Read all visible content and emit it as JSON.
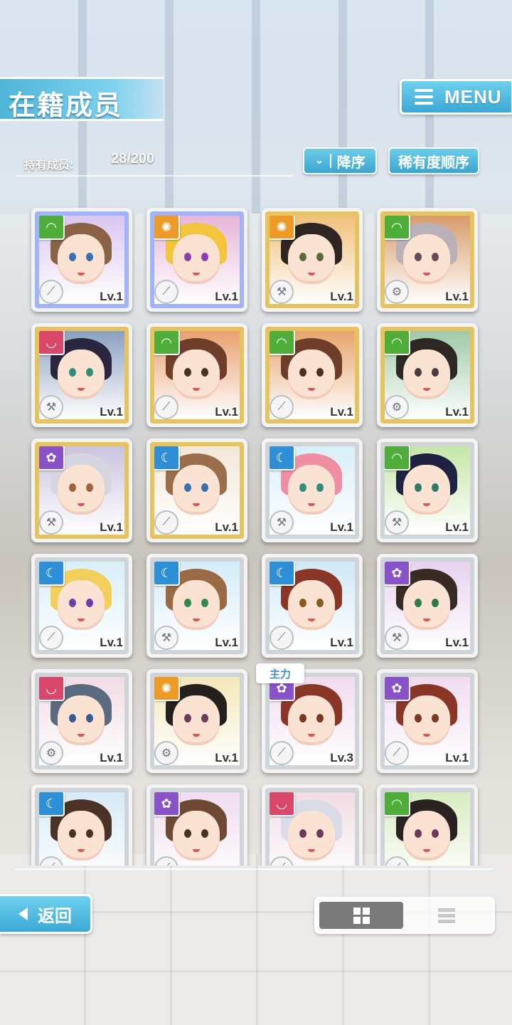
{
  "header": {
    "title": "在籍成员",
    "menu_label": "MENU",
    "member_label": "持有成员:",
    "member_count": "28/200",
    "sort_order_label": "降序",
    "sort_order_icon": "double-chevron-down-icon",
    "sort_key_label": "稀有度顺序"
  },
  "leader_tag": "主力",
  "cards": [
    {
      "level": "Lv.1",
      "attr": "green",
      "type": "sword",
      "frame": "rainbow",
      "hair": "#8a6246",
      "eyes": "#3a6fb0",
      "bg": "#d9c7ef"
    },
    {
      "level": "Lv.1",
      "attr": "orange",
      "type": "sword",
      "frame": "rainbow",
      "hair": "#f3c53a",
      "eyes": "#8b3fa8",
      "bg": "#e7b5d8"
    },
    {
      "level": "Lv.1",
      "attr": "orange",
      "type": "wrench",
      "frame": "gold",
      "hair": "#2e2523",
      "eyes": "#5a6a3a",
      "bg": "#f0c07a"
    },
    {
      "level": "Lv.1",
      "attr": "green",
      "type": "gear",
      "frame": "gold",
      "hair": "#b9b0b8",
      "eyes": "#6b4a5a",
      "bg": "#d79b6a"
    },
    {
      "level": "Lv.1",
      "attr": "pink",
      "type": "wrench",
      "frame": "gold",
      "hair": "#2a2640",
      "eyes": "#2f8f7a",
      "bg": "#8aa0c0"
    },
    {
      "level": "Lv.1",
      "attr": "green",
      "type": "sword",
      "frame": "gold",
      "hair": "#6e3e2a",
      "eyes": "#4a3020",
      "bg": "#e9a070"
    },
    {
      "level": "Lv.1",
      "attr": "green",
      "type": "sword",
      "frame": "gold",
      "hair": "#6e3e2a",
      "eyes": "#4a3020",
      "bg": "#e7a46c"
    },
    {
      "level": "Lv.1",
      "attr": "green",
      "type": "gear",
      "frame": "gold",
      "hair": "#2e2824",
      "eyes": "#4a3a40",
      "bg": "#9fc9a8"
    },
    {
      "level": "Lv.1",
      "attr": "purple",
      "type": "wrench",
      "frame": "gold",
      "hair": "#d6d6e2",
      "eyes": "#a0623a",
      "bg": "#c9c3e0"
    },
    {
      "level": "Lv.1",
      "attr": "blue",
      "type": "sword",
      "frame": "gold",
      "hair": "#9a6e4a",
      "eyes": "#3a6fb0",
      "bg": "#f3e7d8"
    },
    {
      "level": "Lv.1",
      "attr": "blue",
      "type": "hammer",
      "frame": "silver",
      "hair": "#ef8da3",
      "eyes": "#2f8f7a",
      "bg": "#d8eef8"
    },
    {
      "level": "Lv.1",
      "attr": "green",
      "type": "wrench",
      "frame": "silver",
      "hair": "#1f2240",
      "eyes": "#2f7a6a",
      "bg": "#c6e6a8"
    },
    {
      "level": "Lv.1",
      "attr": "blue",
      "type": "sword",
      "frame": "silver",
      "hair": "#f2cf5a",
      "eyes": "#6b3fa8",
      "bg": "#d8eef8"
    },
    {
      "level": "Lv.1",
      "attr": "blue",
      "type": "hammer",
      "frame": "silver",
      "hair": "#9a6a44",
      "eyes": "#2f8a4a",
      "bg": "#d4ecf8"
    },
    {
      "level": "Lv.1",
      "attr": "blue",
      "type": "sword",
      "frame": "silver",
      "hair": "#8a3626",
      "eyes": "#8a5a20",
      "bg": "#cfe8f6"
    },
    {
      "level": "Lv.1",
      "attr": "purple",
      "type": "wrench",
      "frame": "silver",
      "hair": "#3a2a24",
      "eyes": "#2f7a4a",
      "bg": "#e6d2f0"
    },
    {
      "level": "Lv.1",
      "attr": "pink",
      "type": "gear",
      "frame": "silver",
      "hair": "#5a6a80",
      "eyes": "#3a5a90",
      "bg": "#f2dce4"
    },
    {
      "level": "Lv.1",
      "attr": "orange",
      "type": "gear",
      "frame": "silver",
      "hair": "#24201e",
      "eyes": "#6a3a5a",
      "bg": "#f4e7b8"
    },
    {
      "level": "Lv.3",
      "attr": "purple",
      "type": "sword",
      "frame": "silver",
      "hair": "#8a3626",
      "eyes": "#7a3a20",
      "bg": "#f0dcef"
    },
    {
      "level": "Lv.1",
      "attr": "purple",
      "type": "sword",
      "frame": "silver",
      "hair": "#8a3626",
      "eyes": "#7a3a20",
      "bg": "#efdcef"
    },
    {
      "level": "",
      "attr": "blue",
      "type": "sword",
      "frame": "silver",
      "hair": "#4a3226",
      "eyes": "#4a3020",
      "bg": "#d6eaf6"
    },
    {
      "level": "",
      "attr": "purple",
      "type": "sword",
      "frame": "silver",
      "hair": "#6e4a34",
      "eyes": "#4a3020",
      "bg": "#f0dcef"
    },
    {
      "level": "",
      "attr": "pink",
      "type": "sword",
      "frame": "silver",
      "hair": "#d9dce6",
      "eyes": "#6a3a5a",
      "bg": "#f2dce4"
    },
    {
      "level": "",
      "attr": "green",
      "type": "sword",
      "frame": "silver",
      "hair": "#2a2220",
      "eyes": "#6a3a5a",
      "bg": "#d8ecc0"
    }
  ],
  "footer": {
    "back_label": "返回",
    "back_icon": "triangle-left-icon",
    "view_grid_icon": "grid-view-icon",
    "view_list_icon": "list-view-icon"
  },
  "colors": {
    "accent": "#3ba8d4",
    "attr_green": "#4fae3a",
    "attr_orange": "#ee9a26",
    "attr_pink": "#d9476a",
    "attr_purple": "#8a52c8",
    "attr_blue": "#2e8fd6"
  }
}
